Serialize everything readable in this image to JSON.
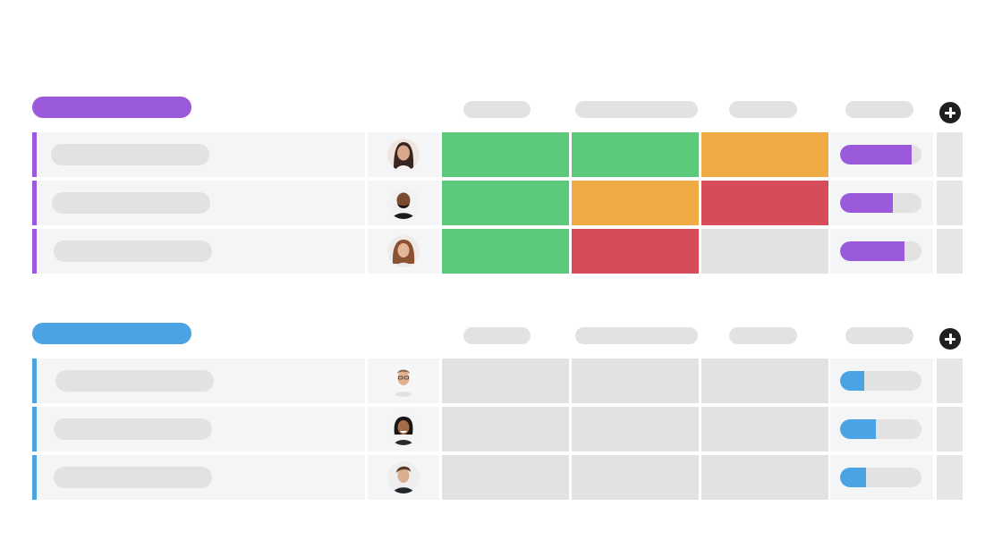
{
  "colors": {
    "purple": "#9b59dc",
    "blue": "#4ca3e3",
    "done": "#5cc87a",
    "working": "#f0aa46",
    "stuck": "#d64d5a",
    "empty": "#e2e2e2",
    "cell_bg": "#f4f5f7",
    "plus_icon": "#1f1f1f"
  },
  "status_legend": {
    "done": "green",
    "working": "orange",
    "stuck": "red",
    "empty": "grey"
  },
  "groups": [
    {
      "color": "purple",
      "add_column_icon": "plus-circle-icon",
      "rows": [
        {
          "avatar": "woman-long-dark-hair",
          "statuses": [
            "done",
            "done",
            "working"
          ],
          "progress": 0.88
        },
        {
          "avatar": "man-bald-beard",
          "statuses": [
            "done",
            "working",
            "stuck"
          ],
          "progress": 0.65
        },
        {
          "avatar": "woman-curly-hair",
          "statuses": [
            "done",
            "stuck",
            "empty"
          ],
          "progress": 0.79
        }
      ]
    },
    {
      "color": "blue",
      "add_column_icon": "plus-circle-icon",
      "rows": [
        {
          "avatar": "man-glasses",
          "statuses": [
            "empty",
            "empty",
            "empty"
          ],
          "progress": 0.29
        },
        {
          "avatar": "woman-dark-hair-smiling",
          "statuses": [
            "empty",
            "empty",
            "empty"
          ],
          "progress": 0.44
        },
        {
          "avatar": "man-short-hair",
          "statuses": [
            "empty",
            "empty",
            "empty"
          ],
          "progress": 0.32
        }
      ]
    }
  ]
}
